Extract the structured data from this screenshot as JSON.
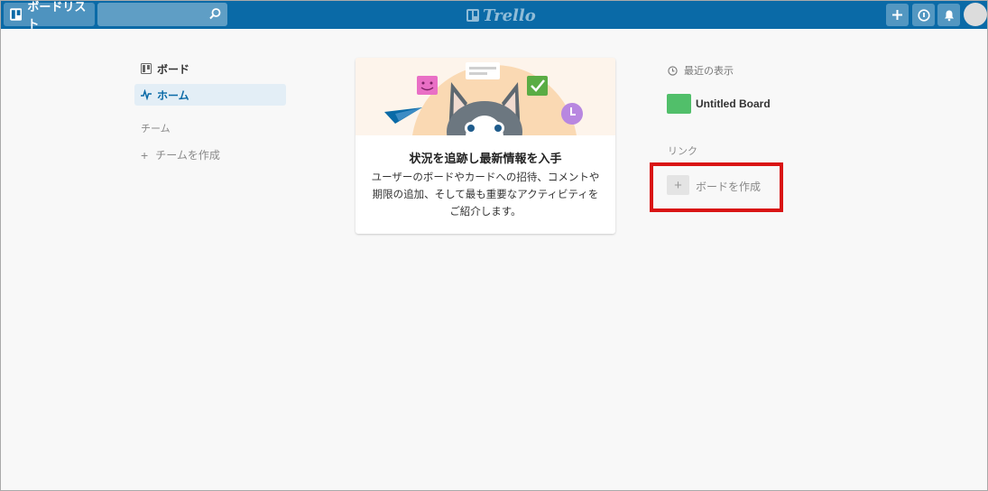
{
  "header": {
    "boards_button": "ボードリスト",
    "search": {
      "value": "",
      "placeholder": ""
    },
    "logo_text": "Trello",
    "icons": [
      "boards-icon",
      "search-icon",
      "add-icon",
      "info-icon",
      "bell-icon",
      "avatar"
    ]
  },
  "sidebar": {
    "items": [
      {
        "label": "ボード",
        "icon": "board-icon",
        "active": false
      },
      {
        "label": "ホーム",
        "icon": "activity-icon",
        "active": true
      }
    ],
    "team_heading": "チーム",
    "create_team": "チームを作成"
  },
  "main": {
    "card_title": "状況を追跡し最新情報を入手",
    "card_body": "ユーザーのボードやカードへの招待、コメントや期限の追加、そして最も重要なアクティビティをご紹介します。"
  },
  "right": {
    "recent_heading": "最近の表示",
    "recent_boards": [
      {
        "name": "Untitled Board",
        "color": "#51bf6a"
      }
    ],
    "links_heading": "リンク",
    "create_board": "ボードを作成"
  },
  "colors": {
    "header": "#0a6aa7",
    "highlight": "#d91414",
    "active_bg": "#e3eef6"
  }
}
